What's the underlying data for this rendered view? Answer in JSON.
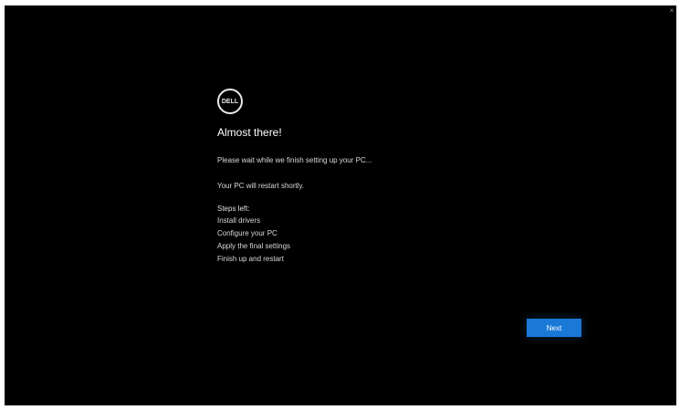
{
  "window": {
    "close_glyph": "×"
  },
  "logo": {
    "text": "DELL"
  },
  "dialog": {
    "title": "Almost there!",
    "paragraphs": [
      "Please wait while we finish setting up your PC...",
      "Your PC will restart shortly."
    ],
    "list_heading": "Steps left:",
    "list_items": [
      "Install drivers",
      "Configure your PC",
      "Apply the final settings",
      "Finish up and restart"
    ]
  },
  "buttons": {
    "next_label": "Next"
  },
  "colors": {
    "background": "#000000",
    "accent": "#1a78d6",
    "text": "#ffffff"
  }
}
